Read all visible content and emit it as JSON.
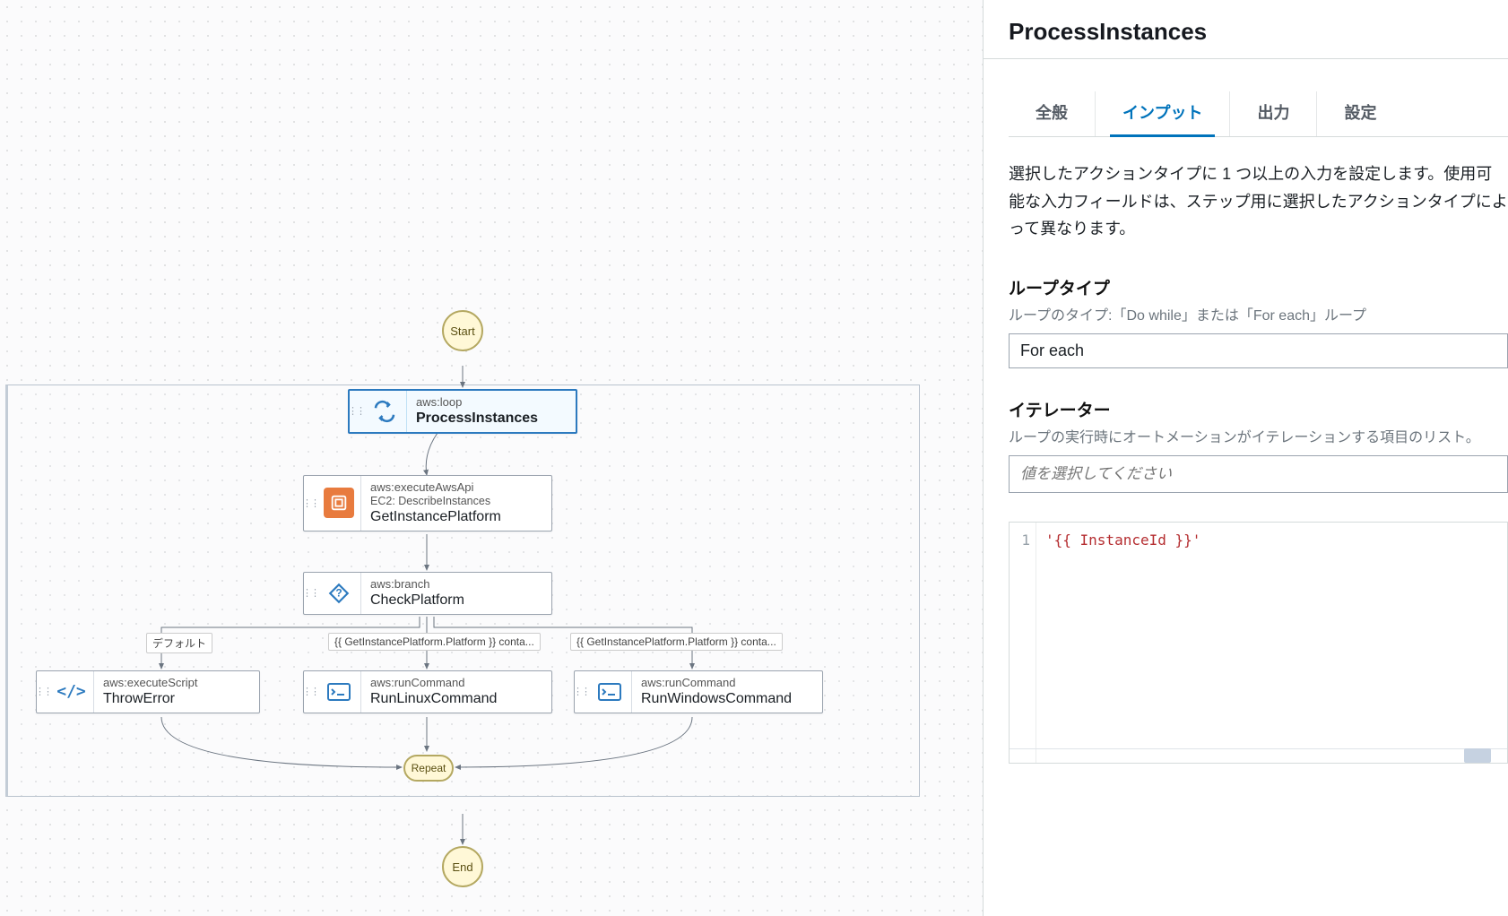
{
  "panelTitle": "ProcessInstances",
  "tabs": [
    "全般",
    "インプット",
    "出力",
    "設定"
  ],
  "activeTab": 1,
  "description": "選択したアクションタイプに 1 つ以上の入力を設定します。使用可能な入力フィールドは、ステップ用に選択したアクションタイプによって異なります。",
  "loopType": {
    "label": "ループタイプ",
    "sub": "ループのタイプ:「Do while」または「For each」ループ",
    "value": "For each"
  },
  "iterator": {
    "label": "イテレーター",
    "sub": "ループの実行時にオートメーションがイテレーションする項目のリスト。",
    "placeholder": "値を選択してください"
  },
  "code": {
    "line": 1,
    "text": "'{{ InstanceId }}'"
  },
  "flow": {
    "start": "Start",
    "repeat": "Repeat",
    "end": "End",
    "defaultLabel": "デフォルト",
    "condLabel": "{{ GetInstancePlatform.Platform }} conta...",
    "nodes": {
      "process": {
        "type": "aws:loop",
        "name": "ProcessInstances",
        "iconName": "loop-icon"
      },
      "getplat": {
        "type": "aws:executeAwsApi",
        "sub": "EC2: DescribeInstances",
        "name": "GetInstancePlatform",
        "iconName": "api-icon"
      },
      "check": {
        "type": "aws:branch",
        "name": "CheckPlatform",
        "iconName": "branch-icon"
      },
      "throw": {
        "type": "aws:executeScript",
        "name": "ThrowError",
        "iconName": "script-icon"
      },
      "linux": {
        "type": "aws:runCommand",
        "name": "RunLinuxCommand",
        "iconName": "command-icon"
      },
      "win": {
        "type": "aws:runCommand",
        "name": "RunWindowsCommand",
        "iconName": "command-icon"
      }
    }
  }
}
